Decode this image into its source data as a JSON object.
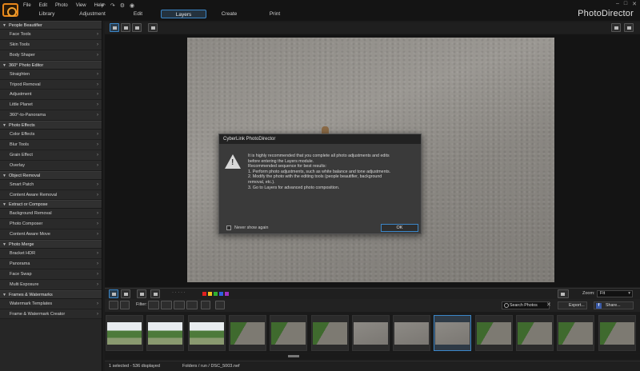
{
  "menubar": {
    "items": [
      "File",
      "Edit",
      "Photo",
      "View",
      "Help"
    ]
  },
  "tabs": [
    {
      "label": "Library"
    },
    {
      "label": "Adjustment"
    },
    {
      "label": "Edit"
    },
    {
      "label": "Layers"
    },
    {
      "label": "Create"
    },
    {
      "label": "Print"
    }
  ],
  "app_title": "PhotoDirector",
  "sidebar": {
    "sections": [
      {
        "title": "People Beautifier",
        "items": [
          "Face Tools",
          "Skin Tools",
          "Body Shaper"
        ]
      },
      {
        "title": "360° Photo Editor",
        "items": [
          "Straighten",
          "Tripod Removal",
          "Adjustment",
          "Little Planet",
          "360°-to-Panorama"
        ]
      },
      {
        "title": "Photo Effects",
        "items": [
          "Color Effects",
          "Blur Tools",
          "Grain Effect",
          "Overlay"
        ]
      },
      {
        "title": "Object Removal",
        "items": [
          "Smart Patch",
          "Content Aware Removal"
        ]
      },
      {
        "title": "Extract or Compose",
        "items": [
          "Background Removal",
          "Photo Composer",
          "Content Aware Move"
        ]
      },
      {
        "title": "Photo Merge",
        "items": [
          "Bracket HDR",
          "Panorama",
          "Face Swap",
          "Multi Exposure"
        ]
      },
      {
        "title": "Frames & Watermarks",
        "items": [
          "Watermark Templates",
          "Frame & Watermark Creator"
        ]
      }
    ]
  },
  "dialog": {
    "title": "CyberLink PhotoDirector",
    "lines": [
      "It is highly recommended that you complete all photo adjustments and edits",
      "before entering the Layers module.",
      "Recommended sequence for best results:",
      "1. Perform photo adjustments, such as white balance and tone adjustments.",
      "2. Modify the photo with the editing tools (people beautifier, background",
      "removal, etc.).",
      "3. Go to Layers for advanced photo composition."
    ],
    "checkbox_label": "Never show again",
    "ok_label": "OK"
  },
  "viewer_bar": {
    "zoom_label": "Zoom:",
    "zoom_value": "Fit",
    "color_labels": [
      "#e02020",
      "#f0c020",
      "#30b030",
      "#3060e0",
      "#a030c0"
    ]
  },
  "library_bar": {
    "filter_label": "Filter:",
    "search_label": "Search Photos",
    "export_label": "Export...",
    "share_label": "Share..."
  },
  "filmstrip": {
    "thumbs": [
      {
        "kind": "trees"
      },
      {
        "kind": "trees"
      },
      {
        "kind": "trees"
      },
      {
        "kind": "grass"
      },
      {
        "kind": "grass"
      },
      {
        "kind": "grass"
      },
      {
        "kind": "gravel"
      },
      {
        "kind": "gravel"
      },
      {
        "kind": "gravel",
        "selected": true
      },
      {
        "kind": "grass"
      },
      {
        "kind": "grass"
      },
      {
        "kind": "grass"
      },
      {
        "kind": "grass"
      }
    ]
  },
  "status": {
    "count": "1 selected - 536 displayed",
    "path": "Folders / run / DSC_5003.nef"
  }
}
